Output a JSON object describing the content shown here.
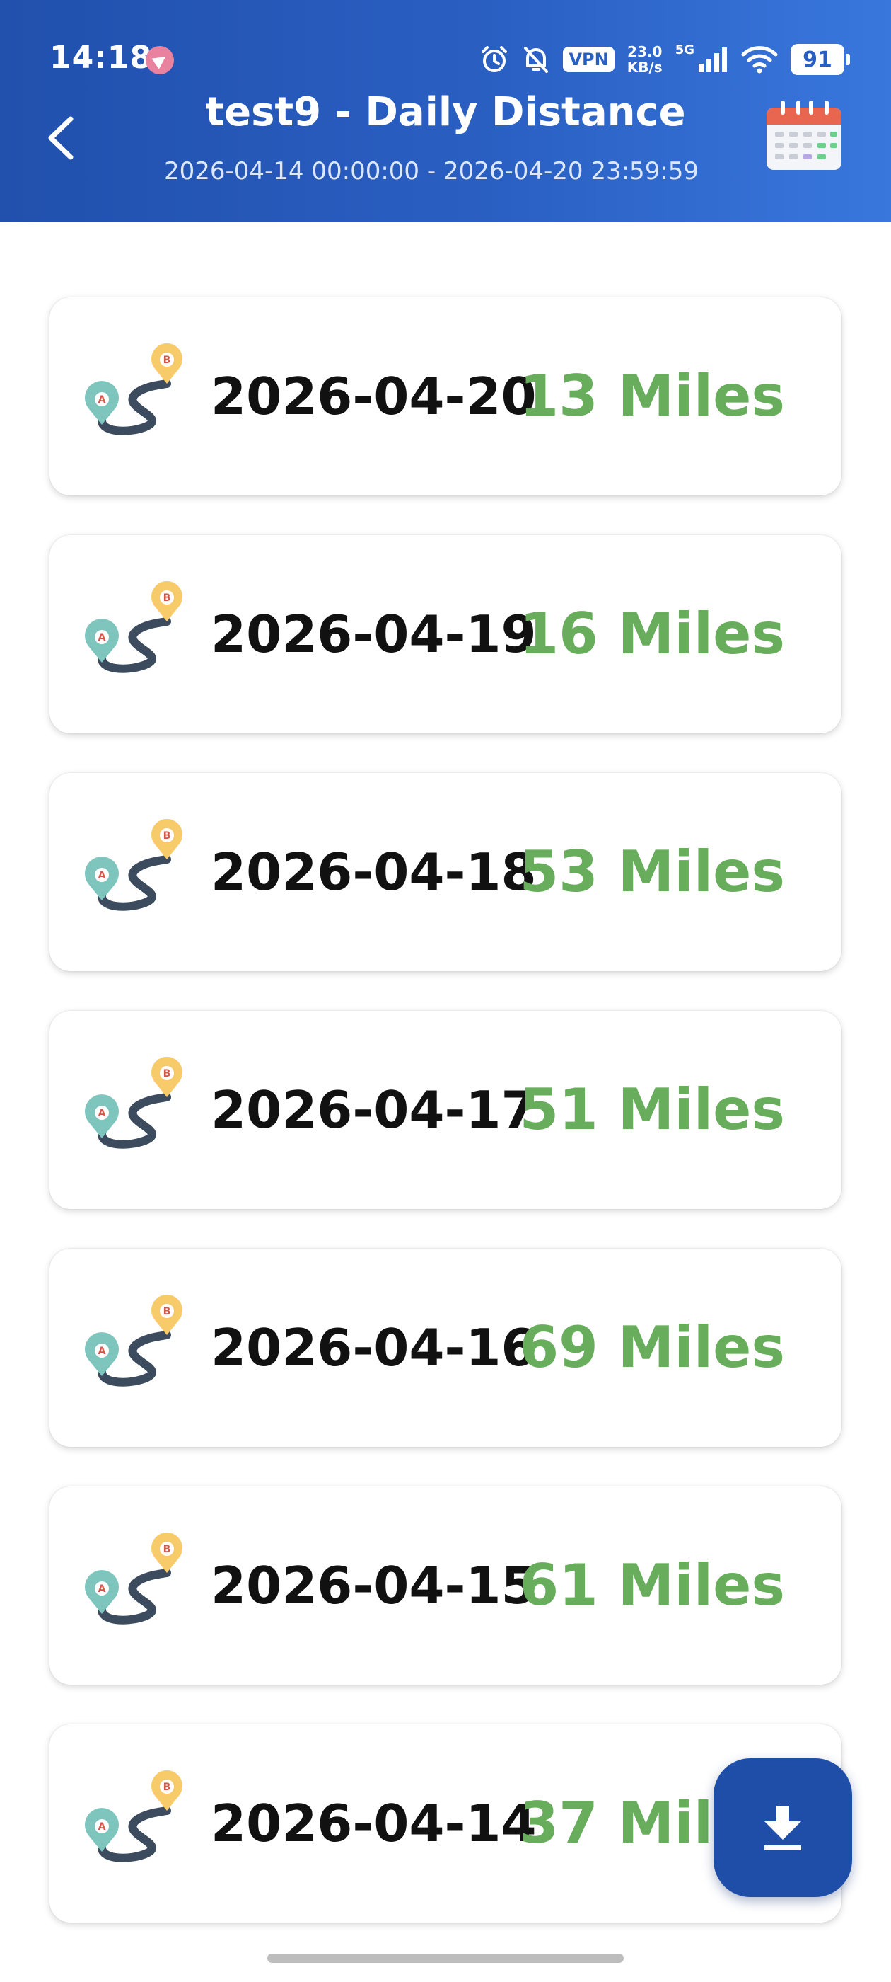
{
  "status_bar": {
    "time": "14:18",
    "vpn": "VPN",
    "speed_value": "23.0",
    "speed_unit": "KB/s",
    "network": "5G",
    "battery": "91",
    "icons": [
      "app-notification-icon",
      "alarm-icon",
      "mute-icon",
      "vpn-icon",
      "signal-icon",
      "wifi-icon",
      "battery-icon"
    ]
  },
  "header": {
    "title": "test9 - Daily Distance",
    "date_range": "2026-04-14 00:00:00  -  2026-04-20 23:59:59",
    "back_icon": "chevron-left-icon",
    "calendar_icon": "calendar-icon"
  },
  "colors": {
    "header_gradient_start": "#2150ad",
    "header_gradient_end": "#3977dd",
    "distance_green": "#67ad5b",
    "fab_blue": "#1f4ea8",
    "pin_a": "#7ec5be",
    "pin_b": "#f7cb6a",
    "road": "#3d4b5e"
  },
  "items": [
    {
      "date": "2026-04-20",
      "distance": "13 Miles"
    },
    {
      "date": "2026-04-19",
      "distance": "16 Miles"
    },
    {
      "date": "2026-04-18",
      "distance": "53 Miles"
    },
    {
      "date": "2026-04-17",
      "distance": "51 Miles"
    },
    {
      "date": "2026-04-16",
      "distance": "69 Miles"
    },
    {
      "date": "2026-04-15",
      "distance": "61 Miles"
    },
    {
      "date": "2026-04-14",
      "distance": "37 Miles"
    }
  ],
  "route_icon": {
    "pin_a_label": "A",
    "pin_b_label": "B"
  },
  "fab": {
    "icon": "download-icon"
  }
}
